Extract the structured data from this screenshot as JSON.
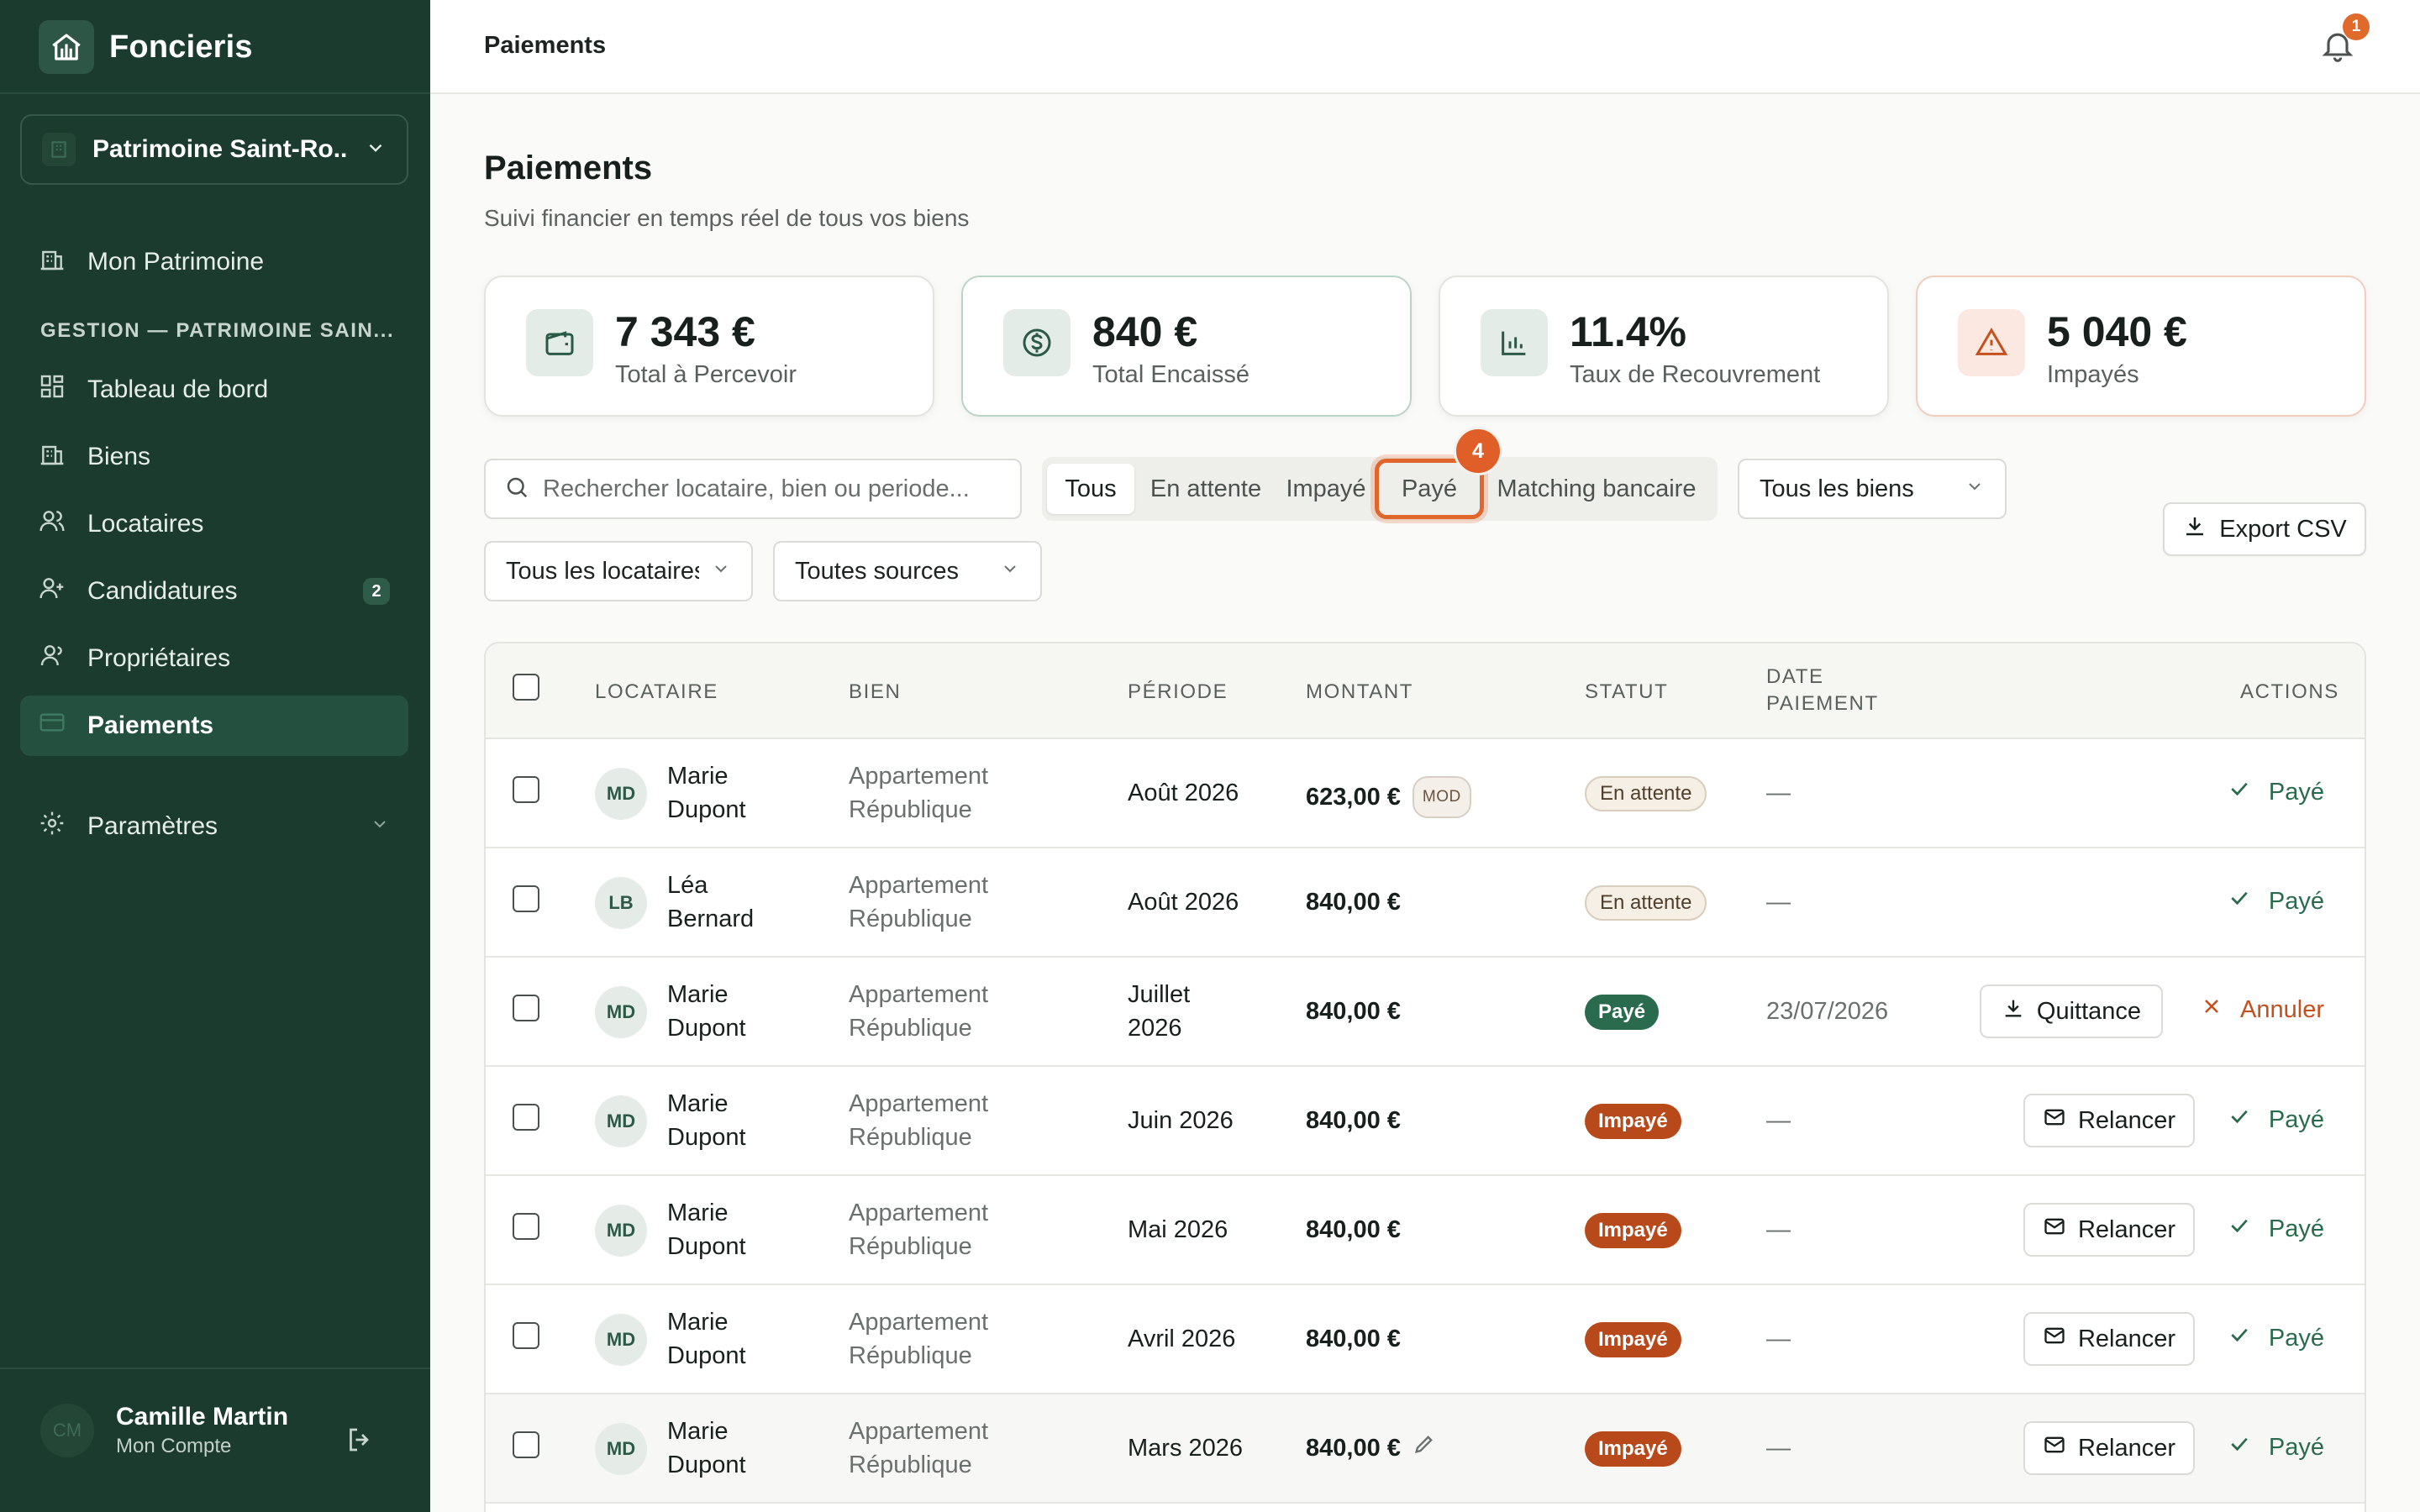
{
  "app": {
    "name": "Foncieris"
  },
  "sidebar": {
    "org_selector": "Patrimoine Saint-Ro...",
    "top_item": "Mon Patrimoine",
    "section_label": "GESTION — PATRIMOINE SAIN...",
    "items": [
      {
        "label": "Tableau de bord",
        "icon": "dashboard-icon"
      },
      {
        "label": "Biens",
        "icon": "building-icon"
      },
      {
        "label": "Locataires",
        "icon": "users-icon"
      },
      {
        "label": "Candidatures",
        "icon": "user-plus-icon",
        "badge": "2"
      },
      {
        "label": "Propriétaires",
        "icon": "user-icon"
      },
      {
        "label": "Paiements",
        "icon": "card-icon",
        "active": true
      }
    ],
    "settings": "Paramètres",
    "user": {
      "initials": "CM",
      "name": "Camille Martin",
      "subtitle": "Mon Compte"
    }
  },
  "topbar": {
    "title": "Paiements",
    "notification_count": "1"
  },
  "page": {
    "title": "Paiements",
    "subtitle": "Suivi financier en temps réel de tous vos biens"
  },
  "stats": [
    {
      "value": "7 343 €",
      "label": "Total à Percevoir",
      "icon": "wallet-icon"
    },
    {
      "value": "840 €",
      "label": "Total Encaissé",
      "icon": "dollar-circle-icon"
    },
    {
      "value": "11.4%",
      "label": "Taux de Recouvrement",
      "icon": "bar-chart-icon"
    },
    {
      "value": "5 040 €",
      "label": "Impayés",
      "icon": "warning-icon"
    }
  ],
  "filters": {
    "search_placeholder": "Rechercher locataire, bien ou periode...",
    "tabs": [
      "Tous",
      "En attente",
      "Impayé",
      "Payé",
      "Matching bancaire"
    ],
    "active_tab": "Tous",
    "highlighted_tab": "Payé",
    "step_badge": "4",
    "biens_select": "Tous les biens",
    "locataires_select": "Tous les locataires",
    "sources_select": "Toutes sources",
    "export_label": "Export CSV"
  },
  "table": {
    "headers": {
      "locataire": "LOCATAIRE",
      "bien": "BIEN",
      "periode": "PÉRIODE",
      "montant": "MONTANT",
      "statut": "STATUT",
      "date_paiement_1": "DATE",
      "date_paiement_2": "PAIEMENT",
      "actions": "ACTIONS"
    },
    "rows": [
      {
        "initials": "MD",
        "first": "Marie",
        "last": "Dupont",
        "bien1": "Appartement",
        "bien2": "République",
        "periode1": "Août 2026",
        "periode2": "",
        "montant": "623,00 €",
        "mod": "MOD",
        "statut": "En attente",
        "date": "—",
        "action": "Payé"
      },
      {
        "initials": "LB",
        "first": "Léa",
        "last": "Bernard",
        "bien1": "Appartement",
        "bien2": "République",
        "periode1": "Août 2026",
        "periode2": "",
        "montant": "840,00 €",
        "statut": "En attente",
        "date": "—",
        "action": "Payé"
      },
      {
        "initials": "MD",
        "first": "Marie",
        "last": "Dupont",
        "bien1": "Appartement",
        "bien2": "République",
        "periode1": "Juillet",
        "periode2": "2026",
        "montant": "840,00 €",
        "statut": "Payé",
        "date": "23/07/2026",
        "button": "Quittance",
        "action": "Annuler"
      },
      {
        "initials": "MD",
        "first": "Marie",
        "last": "Dupont",
        "bien1": "Appartement",
        "bien2": "République",
        "periode1": "Juin 2026",
        "periode2": "",
        "montant": "840,00 €",
        "statut": "Impayé",
        "date": "—",
        "button": "Relancer",
        "action": "Payé"
      },
      {
        "initials": "MD",
        "first": "Marie",
        "last": "Dupont",
        "bien1": "Appartement",
        "bien2": "République",
        "periode1": "Mai 2026",
        "periode2": "",
        "montant": "840,00 €",
        "statut": "Impayé",
        "date": "—",
        "button": "Relancer",
        "action": "Payé"
      },
      {
        "initials": "MD",
        "first": "Marie",
        "last": "Dupont",
        "bien1": "Appartement",
        "bien2": "République",
        "periode1": "Avril 2026",
        "periode2": "",
        "montant": "840,00 €",
        "statut": "Impayé",
        "date": "—",
        "button": "Relancer",
        "action": "Payé"
      },
      {
        "initials": "MD",
        "first": "Marie",
        "last": "Dupont",
        "bien1": "Appartement",
        "bien2": "République",
        "periode1": "Mars 2026",
        "periode2": "",
        "montant": "840,00 €",
        "statut": "Impayé",
        "date": "—",
        "button": "Relancer",
        "action": "Payé"
      }
    ]
  },
  "colors": {
    "sidebar_bg": "#1b3b2f",
    "accent_green": "#2a6b4e",
    "accent_orange": "#e0662b",
    "impaye": "#b8491a"
  }
}
